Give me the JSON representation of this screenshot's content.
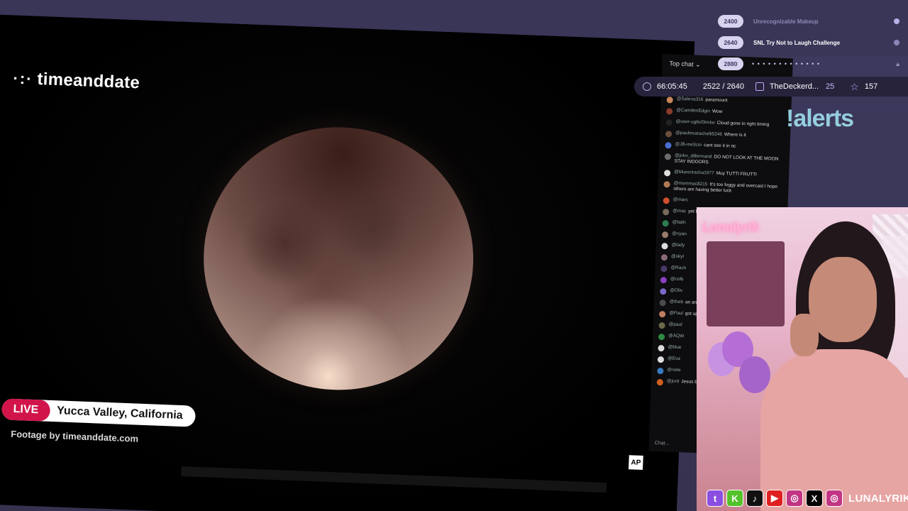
{
  "video": {
    "logo_text": "timeanddate",
    "live_label": "LIVE",
    "location": "Yucca Valley, California",
    "footage_credit": "Footage by timeanddate.com",
    "ap_badge": "AP"
  },
  "chat": {
    "filter_label": "Top chat",
    "input_placeholder": "Chat...",
    "messages": [
      {
        "user": "@Salena316",
        "text": "paramount",
        "color": "#c9855a"
      },
      {
        "user": "@CamdenEdgin",
        "text": "Wow",
        "color": "#8a3b2a"
      },
      {
        "user": "@user-ug6of3m4w",
        "text": "Cloud gone in right timing",
        "color": "#222"
      },
      {
        "user": "@pauliesarachelli5246",
        "text": "Where is it",
        "color": "#6b4e3d"
      },
      {
        "user": "@JB-me3cm",
        "text": "cant see it in nc",
        "color": "#4a6fd1"
      },
      {
        "user": "@john_dillermand",
        "text": "DO NOT LOOK AT THE MOON STAY INDOORS",
        "color": "#6d6d6d"
      },
      {
        "user": "@bluesriracha1977",
        "text": "Muy TUTTI FRUTTI",
        "color": "#dddddd"
      },
      {
        "user": "@mommac8215",
        "text": "It's too foggy and overcast I hope others are having better luck",
        "color": "#b07a55"
      },
      {
        "user": "@marc",
        "text": "",
        "color": "#d0502d"
      },
      {
        "user": "@mac",
        "text": "yet BC",
        "color": "#7a6a5a"
      },
      {
        "user": "@faith",
        "text": "",
        "color": "#2e7d4f"
      },
      {
        "user": "@nyan",
        "text": "",
        "color": "#9a7a6a"
      },
      {
        "user": "@lady",
        "text": "",
        "color": "#dddddd"
      },
      {
        "user": "@skyl",
        "text": "",
        "color": "#8a6a7a"
      },
      {
        "user": "@Rach",
        "text": "",
        "color": "#4a3a6a"
      },
      {
        "user": "@colb",
        "text": "",
        "color": "#8a40c0"
      },
      {
        "user": "@Oliv",
        "text": "",
        "color": "#7a68c8"
      },
      {
        "user": "@theb",
        "text": "an arm",
        "color": "#4a4a4a"
      },
      {
        "user": "@Paul",
        "text": "got up",
        "color": "#c08060"
      },
      {
        "user": "@paul",
        "text": "",
        "color": "#6a6a4a"
      },
      {
        "user": "@AQW",
        "text": "",
        "color": "#2e8a40"
      },
      {
        "user": "@blue",
        "text": "",
        "color": "#dddddd"
      },
      {
        "user": "@Eva",
        "text": "",
        "color": "#dddddd"
      },
      {
        "user": "@nete",
        "text": "",
        "color": "#3a7ac0"
      },
      {
        "user": "@jord",
        "text": "Jesus bad.",
        "color": "#d06020"
      }
    ]
  },
  "goals": [
    {
      "value": "2400",
      "label": "Unrecognizable Makeup",
      "dim": true
    },
    {
      "value": "2640",
      "label": "SNL Try Not to Laugh Challenge",
      "dim": false
    },
    {
      "value": "2880",
      "label": "",
      "dim": false
    }
  ],
  "stats": {
    "uptime": "66:05:45",
    "progress": "2522 / 2640",
    "progress_value": 2522,
    "progress_target": 2640,
    "gifter_name": "TheDeckerd...",
    "gifter_count": "25",
    "star_count": "157"
  },
  "overlay": {
    "alerts_text": "!alerts"
  },
  "webcam": {
    "sign_text": "Lunalyrik"
  },
  "socials": {
    "handle": "LUNALYRIK",
    "icons": [
      "twitch-icon",
      "kick-icon",
      "tiktok-icon",
      "youtube-icon",
      "instagram-icon",
      "x-icon",
      "instagram-icon"
    ]
  },
  "colors": {
    "background": "#3b3758",
    "live_red": "#d1144a",
    "goal_pill": "#d7d2ee",
    "accent_purple": "#c7a6ff"
  }
}
